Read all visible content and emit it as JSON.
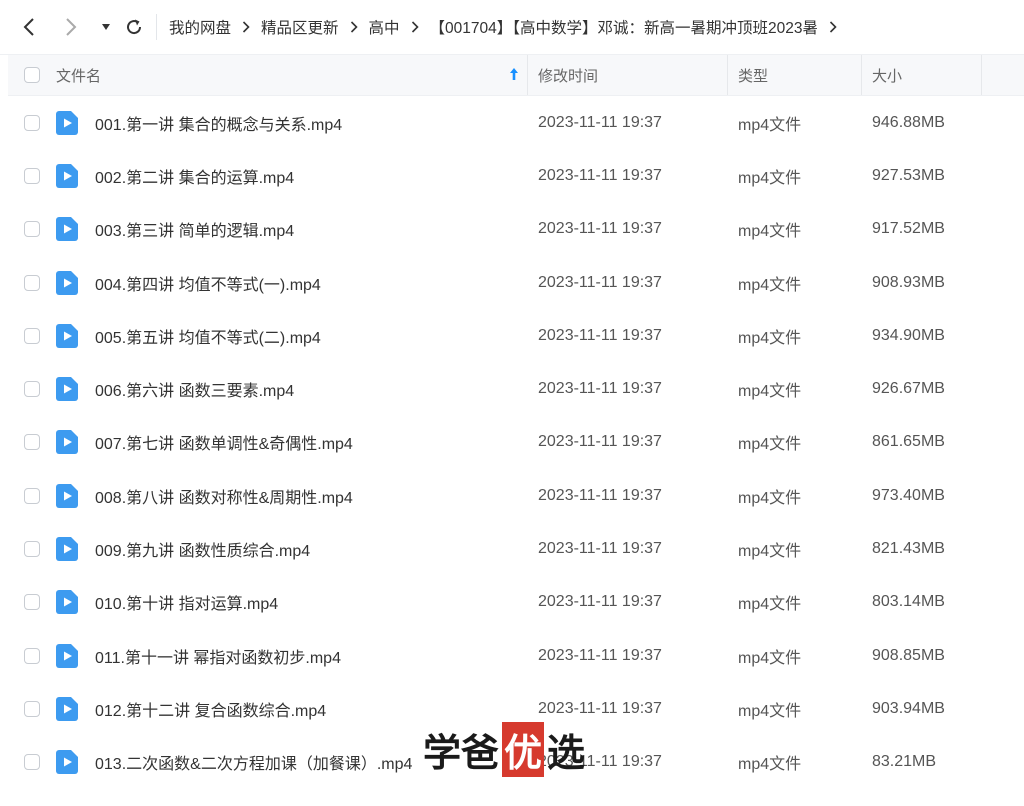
{
  "breadcrumb": [
    "我的网盘",
    "精品区更新",
    "高中",
    "【001704】【高中数学】邓诚：新高一暑期冲顶班2023暑"
  ],
  "header": {
    "name": "文件名",
    "time": "修改时间",
    "type": "类型",
    "size": "大小"
  },
  "files": [
    {
      "name": "001.第一讲 集合的概念与关系.mp4",
      "time": "2023-11-11 19:37",
      "type": "mp4文件",
      "size": "946.88MB"
    },
    {
      "name": "002.第二讲 集合的运算.mp4",
      "time": "2023-11-11 19:37",
      "type": "mp4文件",
      "size": "927.53MB"
    },
    {
      "name": "003.第三讲 简单的逻辑.mp4",
      "time": "2023-11-11 19:37",
      "type": "mp4文件",
      "size": "917.52MB"
    },
    {
      "name": "004.第四讲 均值不等式(一).mp4",
      "time": "2023-11-11 19:37",
      "type": "mp4文件",
      "size": "908.93MB"
    },
    {
      "name": "005.第五讲 均值不等式(二).mp4",
      "time": "2023-11-11 19:37",
      "type": "mp4文件",
      "size": "934.90MB"
    },
    {
      "name": "006.第六讲 函数三要素.mp4",
      "time": "2023-11-11 19:37",
      "type": "mp4文件",
      "size": "926.67MB"
    },
    {
      "name": "007.第七讲 函数单调性&奇偶性.mp4",
      "time": "2023-11-11 19:37",
      "type": "mp4文件",
      "size": "861.65MB"
    },
    {
      "name": "008.第八讲 函数对称性&周期性.mp4",
      "time": "2023-11-11 19:37",
      "type": "mp4文件",
      "size": "973.40MB"
    },
    {
      "name": "009.第九讲 函数性质综合.mp4",
      "time": "2023-11-11 19:37",
      "type": "mp4文件",
      "size": "821.43MB"
    },
    {
      "name": "010.第十讲 指对运算.mp4",
      "time": "2023-11-11 19:37",
      "type": "mp4文件",
      "size": "803.14MB"
    },
    {
      "name": "011.第十一讲 幂指对函数初步.mp4",
      "time": "2023-11-11 19:37",
      "type": "mp4文件",
      "size": "908.85MB"
    },
    {
      "name": "012.第十二讲 复合函数综合.mp4",
      "time": "2023-11-11 19:37",
      "type": "mp4文件",
      "size": "903.94MB"
    },
    {
      "name": "013.二次函数&二次方程加课（加餐课）.mp4",
      "time": "2023-11-11 19:37",
      "type": "mp4文件",
      "size": "83.21MB"
    }
  ],
  "watermark": {
    "a": "学爸",
    "b": "优",
    "c": "选"
  },
  "colors": {
    "accent": "#1890ff",
    "file_icon": "#3d9bf0",
    "watermark_red": "#d63a2e"
  },
  "icons": {
    "back": "chevron-left-icon",
    "forward": "chevron-right-icon",
    "dropdown": "caret-down-icon",
    "refresh": "refresh-icon",
    "sort": "sort-up-arrow-icon",
    "file": "video-file-icon"
  }
}
